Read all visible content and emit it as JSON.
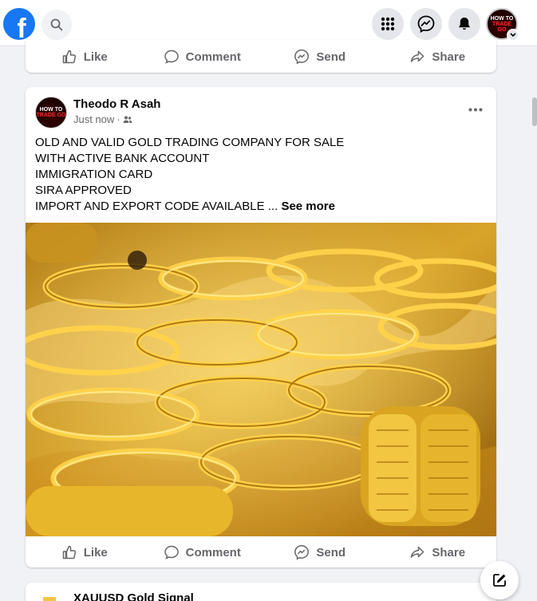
{
  "topbar": {
    "logo_letter": "f",
    "avatar_lines": [
      "HOW TO",
      "TRADE GO"
    ]
  },
  "prev_post": {
    "actions": [
      "Like",
      "Comment",
      "Send",
      "Share"
    ]
  },
  "post": {
    "author": "Theodo R Asah",
    "timestamp": "Just now",
    "meta_separator": "·",
    "text_lines": [
      "OLD AND VALID GOLD TRADING COMPANY FOR SALE",
      "WITH ACTIVE BANK ACCOUNT",
      "IMMIGRATION CARD",
      "SIRA APPROVED",
      "IMPORT AND EXPORT CODE AVAILABLE ..."
    ],
    "see_more": "See more",
    "actions": [
      "Like",
      "Comment",
      "Send",
      "Share"
    ],
    "image_subject": "gold bangles on display"
  },
  "next_post": {
    "author": "XAUUSD Gold Signal"
  },
  "colors": {
    "brand": "#1877f2",
    "secondary_text": "#65676b",
    "page_bg": "#f0f2f5",
    "gold": "#e0b21e"
  }
}
